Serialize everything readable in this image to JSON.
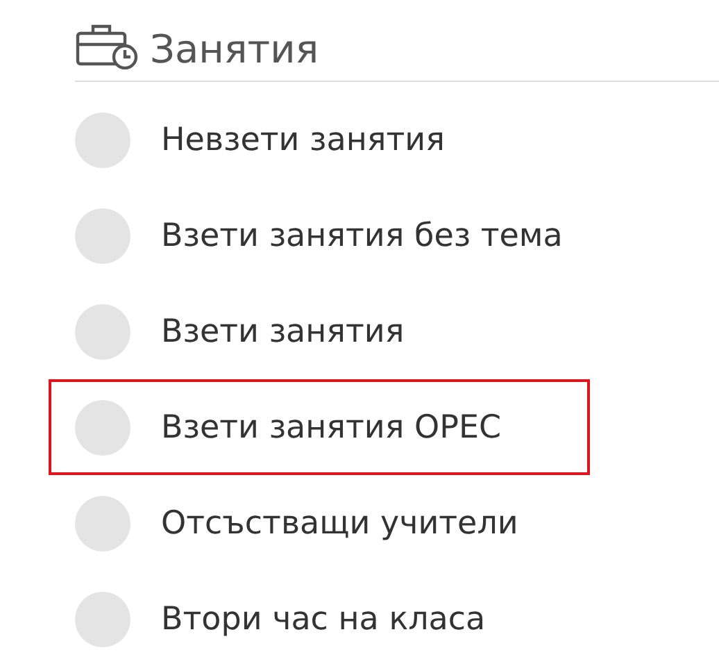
{
  "section": {
    "title": "Занятия"
  },
  "items": [
    {
      "label": "Невзети занятия",
      "highlighted": false
    },
    {
      "label": "Взети занятия без тема",
      "highlighted": false
    },
    {
      "label": "Взети занятия",
      "highlighted": false
    },
    {
      "label": "Взети занятия ОРЕС",
      "highlighted": true
    },
    {
      "label": "Отсъстващи учители",
      "highlighted": false
    },
    {
      "label": "Втори час на класа",
      "highlighted": false
    }
  ]
}
